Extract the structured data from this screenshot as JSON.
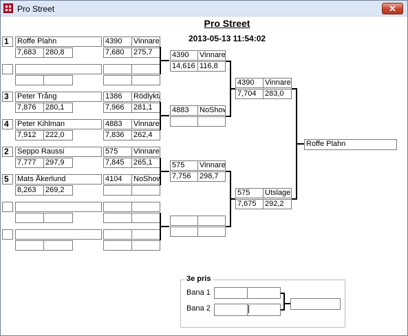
{
  "window": {
    "title": "Pro Street",
    "close_symbol": "✕"
  },
  "header": {
    "title": "Pro Street",
    "datetime": "2013-05-13 11:54:02"
  },
  "round1": [
    {
      "seed": "1",
      "name": "Roffe Plahn",
      "reaction": "7,683",
      "speed": "280,8",
      "id": "4390",
      "result": "Vinnare",
      "et": "7,680",
      "mph": "275,7"
    },
    {
      "seed": "",
      "name": "",
      "reaction": "",
      "speed": "",
      "id": "",
      "result": "",
      "et": "",
      "mph": ""
    },
    {
      "seed": "3",
      "name": "Peter Trång",
      "reaction": "7,876",
      "speed": "280,1",
      "id": "1386",
      "result": "Rödlykta",
      "et": "7,966",
      "mph": "281,1"
    },
    {
      "seed": "4",
      "name": "Peter Kihlman",
      "reaction": "7,912",
      "speed": "222,0",
      "id": "4883",
      "result": "Vinnare",
      "et": "7,836",
      "mph": "262,4"
    },
    {
      "seed": "2",
      "name": "Seppo Raussi",
      "reaction": "7,777",
      "speed": "297,9",
      "id": "575",
      "result": "Vinnare",
      "et": "7,845",
      "mph": "265,1"
    },
    {
      "seed": "5",
      "name": "Mats Åkerlund",
      "reaction": "8,263",
      "speed": "269,2",
      "id": "4104",
      "result": "NoShow",
      "et": "",
      "mph": ""
    },
    {
      "seed": "",
      "name": "",
      "reaction": "",
      "speed": "",
      "id": "",
      "result": "",
      "et": "",
      "mph": ""
    },
    {
      "seed": "",
      "name": "",
      "reaction": "",
      "speed": "",
      "id": "",
      "result": "",
      "et": "",
      "mph": ""
    }
  ],
  "round2": [
    {
      "id": "4390",
      "result": "Vinnare",
      "et": "14,616",
      "mph": "116,8"
    },
    {
      "id": "4883",
      "result": "NoShow",
      "et": "",
      "mph": ""
    },
    {
      "id": "575",
      "result": "Vinnare",
      "et": "7,756",
      "mph": "298,7"
    },
    {
      "id": "",
      "result": "",
      "et": "",
      "mph": ""
    }
  ],
  "round3": [
    {
      "id": "4390",
      "result": "Vinnare",
      "et": "7,704",
      "mph": "283,0"
    },
    {
      "id": "575",
      "result": "Utslagen",
      "et": "7,675",
      "mph": "292,2"
    }
  ],
  "final": {
    "winner": "Roffe Plahn"
  },
  "third_place": {
    "title": "3e pris",
    "lanes": [
      {
        "label": "Bana 1",
        "id": "",
        "result": ""
      },
      {
        "label": "Bana 2",
        "id": "",
        "result": ""
      }
    ],
    "winner": ""
  }
}
